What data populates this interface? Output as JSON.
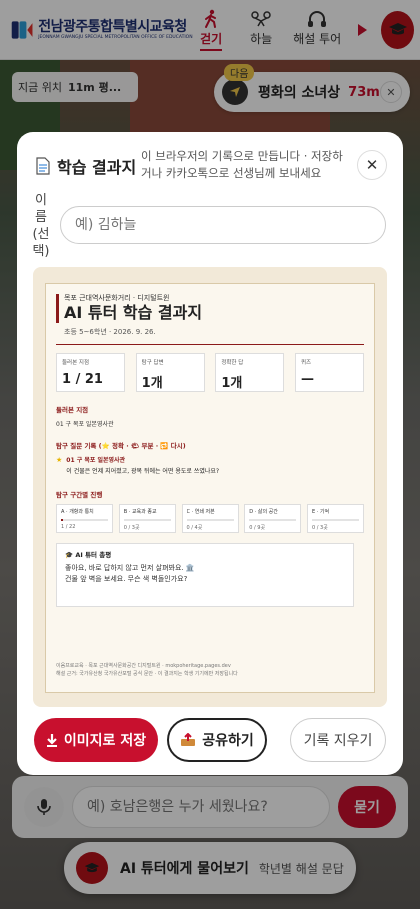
{
  "header": {
    "logo_title": "전남광주통합특별시교육청",
    "logo_subtitle": "JEONNAM GWANGJU SPECIAL METROPOLITAN OFFICE OF EDUCATION",
    "tabs": [
      {
        "label": "걷기",
        "icon": "walking-person-icon",
        "active": true
      },
      {
        "label": "하늘",
        "icon": "drone-icon",
        "active": false
      },
      {
        "label": "해설 투어",
        "icon": "headphones-icon",
        "active": false
      }
    ],
    "accent_color": "#c8102e"
  },
  "location": {
    "label": "지금 위치",
    "value": "11m 평..."
  },
  "next_stop": {
    "badge": "다음",
    "name": "평화의 소녀상",
    "distance": "73m"
  },
  "modal": {
    "title": "학습 결과지",
    "description": "이 브라우저의 기록으로 만듭니다 · 저장하거나 카카오톡으로 선생님께 보내세요",
    "name_label": "이름(선택)",
    "name_placeholder": "예) 김하늘",
    "sheet": {
      "venue": "목포 근대역사문화거리 · 디지털트윈",
      "title": "AI 튜터 학습 결과지",
      "meta": "초등 5~6학년 · 2026. 9. 26.",
      "stats": [
        {
          "label": "둘러본 지점",
          "value": "1 / 21"
        },
        {
          "label": "탐구 답변",
          "value": "1개"
        },
        {
          "label": "정확한 답",
          "value": "1개"
        },
        {
          "label": "퀴즈",
          "value": "—"
        }
      ],
      "visited_heading": "둘러본 지점",
      "visited_item": "01 구 목포 일본영사관",
      "question_heading": "탐구 질문 기록 (⭐ 정확 · 🌤 부분 · 🔁 다시)",
      "question_place": "01 구 목포 일본영사관",
      "question_text": "이 건물은 언제 지어졌고, 광복 뒤에는 어떤 용도로 쓰였나요?",
      "sections_heading": "탐구 구간별 진행",
      "sections": [
        {
          "name": "A · 개항과 통치",
          "count": "1 / 22",
          "progress": 0.05
        },
        {
          "name": "B · 교육과 종교",
          "count": "0 / 3곳",
          "progress": 0
        },
        {
          "name": "C · 연쇄 저본",
          "count": "0 / 4곳",
          "progress": 0
        },
        {
          "name": "D · 삶의 공간",
          "count": "0 / 9곳",
          "progress": 0
        },
        {
          "name": "E · 기억",
          "count": "0 / 3곳",
          "progress": 0
        }
      ],
      "review_heading": "🎓 AI 튜터 총평",
      "review_text_1": "좋아요, 바로 답하지 않고 먼저 살펴봐요. 🏛️",
      "review_text_2": "건물 앞 벽을 보세요. 무슨 색 벽돌인가요?",
      "footer_1": "이음프로교육 · 목포 근대역사문화공간 디지털트윈 · mokpoheritage.pages.dev",
      "footer_2": "해설 근거: 국가유산청 국가유산포털 공식 문안 · 이 결과지는 학생 기기에만 저장됩니다"
    },
    "buttons": {
      "save": "이미지로 저장",
      "share": "공유하기",
      "clear": "기록 지우기"
    }
  },
  "bottom": {
    "question_placeholder": "예) 호남은행은 누가 세웠나요?",
    "ask_label": "묻기",
    "tutor_pill_title": "AI 튜터에게 물어보기",
    "tutor_pill_sub": "학년별 해설 문답"
  }
}
